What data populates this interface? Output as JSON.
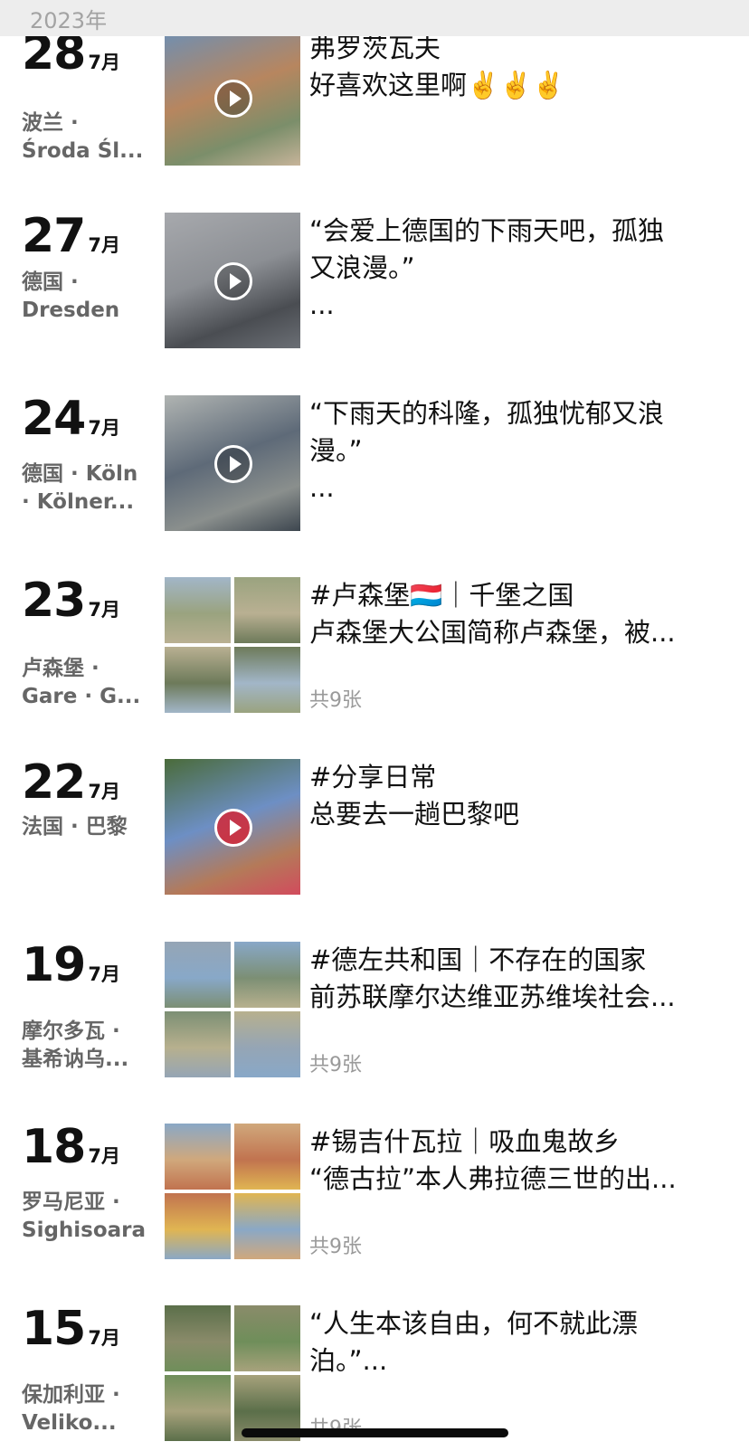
{
  "header": {
    "year": "2023年"
  },
  "posts": [
    {
      "day": "28",
      "month": "7月",
      "location": [
        "波兰 ·",
        "Środa Śl..."
      ],
      "lines": [
        "弗罗茨瓦夫",
        "好喜欢这里啊✌️✌️✌️"
      ],
      "media": "video",
      "count": ""
    },
    {
      "day": "27",
      "month": "7月",
      "location": [
        "德国 ·",
        "Dresden"
      ],
      "lines": [
        "“会爱上德国的下雨天吧，孤独",
        "又浪漫。”",
        "..."
      ],
      "media": "video",
      "count": ""
    },
    {
      "day": "24",
      "month": "7月",
      "location": [
        "德国 · Köln",
        "· Kölner..."
      ],
      "lines": [
        "“下雨天的科隆，孤独忧郁又浪",
        "漫。”",
        "..."
      ],
      "media": "video",
      "count": ""
    },
    {
      "day": "23",
      "month": "7月",
      "location": [
        "卢森堡 ·",
        "Gare · G..."
      ],
      "lines": [
        "#卢森堡🇱🇺｜千堡之国",
        "卢森堡大公国简称卢森堡，被..."
      ],
      "media": "grid",
      "count": "共9张"
    },
    {
      "day": "22",
      "month": "7月",
      "location": [
        "法国 · 巴黎"
      ],
      "lines": [
        "#分享日常",
        "总要去一趟巴黎吧"
      ],
      "media": "video",
      "count": ""
    },
    {
      "day": "19",
      "month": "7月",
      "location": [
        "摩尔多瓦 ·",
        "基希讷乌..."
      ],
      "lines": [
        "#德左共和国｜不存在的国家",
        "前苏联摩尔达维亚苏维埃社会..."
      ],
      "media": "grid",
      "count": "共9张"
    },
    {
      "day": "18",
      "month": "7月",
      "location": [
        "罗马尼亚 ·",
        "Sighisoara"
      ],
      "lines": [
        "#锡吉什瓦拉｜吸血鬼故乡",
        "“德古拉”本人弗拉德三世的出..."
      ],
      "media": "grid",
      "count": "共9张"
    },
    {
      "day": "15",
      "month": "7月",
      "location": [
        "保加利亚 ·",
        "Veliko..."
      ],
      "lines": [
        "“人生本该自由，何不就此漂",
        "泊。”..."
      ],
      "media": "grid",
      "count": "共9张"
    }
  ],
  "colors": {
    "year_bar": "#ededed",
    "year_text": "#a3a3a3",
    "location": "#666666",
    "count": "#9a9a9a"
  },
  "icons": {
    "video": "play-icon"
  }
}
